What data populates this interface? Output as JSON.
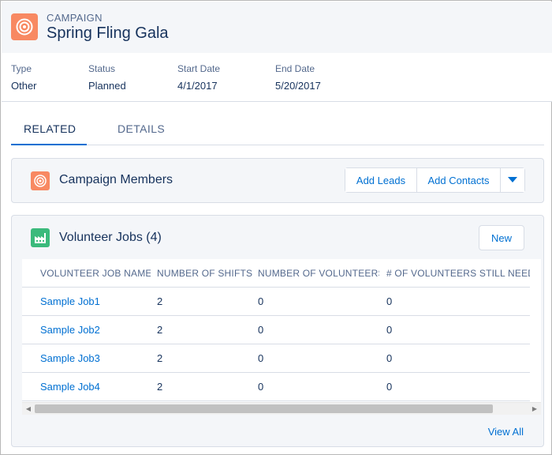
{
  "record": {
    "object_label": "CAMPAIGN",
    "title": "Spring Fling Gala",
    "icon": "target-icon",
    "brand_color": "#f88962"
  },
  "highlights": [
    {
      "label": "Type",
      "value": "Other"
    },
    {
      "label": "Status",
      "value": "Planned"
    },
    {
      "label": "Start Date",
      "value": "4/1/2017"
    },
    {
      "label": "End Date",
      "value": "5/20/2017"
    }
  ],
  "tabs": [
    {
      "label": "RELATED",
      "active": true
    },
    {
      "label": "DETAILS",
      "active": false
    }
  ],
  "campaign_members": {
    "title": "Campaign Members",
    "icon": "target-icon",
    "add_leads_label": "Add Leads",
    "add_contacts_label": "Add Contacts",
    "menu_icon": "chevron-down-icon"
  },
  "volunteer_jobs": {
    "title": "Volunteer Jobs (4)",
    "icon": "factory-icon",
    "icon_color": "#3bba7c",
    "new_label": "New",
    "columns": [
      "VOLUNTEER JOB NAME",
      "NUMBER OF SHIFTS",
      "NUMBER OF VOLUNTEERS",
      "# OF VOLUNTEERS STILL NEED..."
    ],
    "rows": [
      {
        "name": "Sample Job1",
        "shifts": "2",
        "volunteers": "0",
        "still_needed": "0"
      },
      {
        "name": "Sample Job2",
        "shifts": "2",
        "volunteers": "0",
        "still_needed": "0"
      },
      {
        "name": "Sample Job3",
        "shifts": "2",
        "volunteers": "0",
        "still_needed": "0"
      },
      {
        "name": "Sample Job4",
        "shifts": "2",
        "volunteers": "0",
        "still_needed": "0"
      }
    ],
    "view_all_label": "View All"
  },
  "colors": {
    "link": "#0070d2",
    "text": "#16325c",
    "muted": "#54698d",
    "card_bg": "#f4f6f9"
  }
}
